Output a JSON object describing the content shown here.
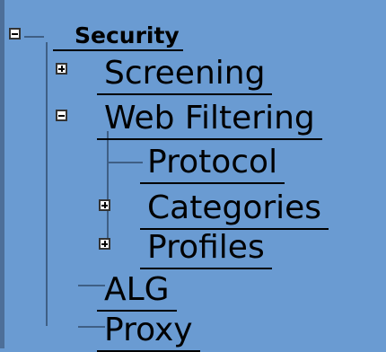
{
  "tree": {
    "root": {
      "label": "Security",
      "expanded": true
    },
    "items": [
      {
        "label": "Screening",
        "expanded": false,
        "has_children": true
      },
      {
        "label": "Web Filtering",
        "expanded": true,
        "has_children": true,
        "children": [
          {
            "label": "Protocol",
            "has_children": false
          },
          {
            "label": "Categories",
            "has_children": true,
            "expanded": false
          },
          {
            "label": "Profiles",
            "has_children": true,
            "expanded": false
          }
        ]
      },
      {
        "label": "ALG",
        "has_children": false
      },
      {
        "label": "Proxy",
        "has_children": false
      }
    ]
  },
  "colors": {
    "background": "#6a9bd2",
    "tree_lines": "#3f5f85",
    "text": "#000000"
  }
}
